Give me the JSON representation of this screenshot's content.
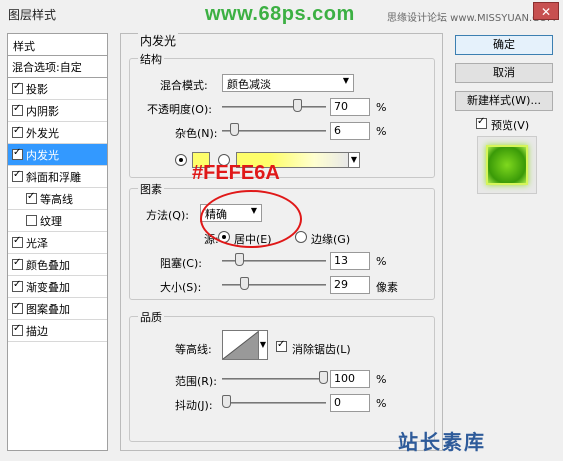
{
  "window": {
    "title": "图层样式",
    "close_glyph": "✕"
  },
  "watermark": {
    "top_url": "www.68ps.com",
    "top_sub": "思缘设计论坛 www.MISSYUAN.COM",
    "bottom": "站长素库"
  },
  "sidebar": {
    "header": "样式",
    "items": [
      {
        "label": "混合选项:自定",
        "check": null
      },
      {
        "label": "投影",
        "check": true
      },
      {
        "label": "内阴影",
        "check": true
      },
      {
        "label": "外发光",
        "check": true
      },
      {
        "label": "内发光",
        "check": true
      },
      {
        "label": "斜面和浮雕",
        "check": true
      },
      {
        "label": "等高线",
        "check": true
      },
      {
        "label": "纹理",
        "check": false
      },
      {
        "label": "光泽",
        "check": true
      },
      {
        "label": "颜色叠加",
        "check": true
      },
      {
        "label": "渐变叠加",
        "check": true
      },
      {
        "label": "图案叠加",
        "check": true
      },
      {
        "label": "描边",
        "check": true
      }
    ]
  },
  "panel": {
    "title": "内发光",
    "structure": {
      "legend": "结构",
      "blend_mode_label": "混合模式:",
      "blend_mode_value": "颜色减淡",
      "opacity_label": "不透明度(O):",
      "opacity_value": "70",
      "noise_label": "杂色(N):",
      "noise_value": "6",
      "percent": "%"
    },
    "elements": {
      "legend": "图素",
      "method_label": "方法(Q):",
      "method_value": "精确",
      "source_label": "源:",
      "source_center": "居中(E)",
      "source_edge": "边缘(G)",
      "choke_label": "阻塞(C):",
      "choke_value": "13",
      "size_label": "大小(S):",
      "size_value": "29",
      "px_unit": "像素"
    },
    "quality": {
      "legend": "品质",
      "contour_label": "等高线:",
      "anti_alias_label": "消除锯齿(L)",
      "range_label": "范围(R):",
      "range_value": "100",
      "jitter_label": "抖动(J):",
      "jitter_value": "0"
    }
  },
  "annotation": {
    "color_text": "#FEFE6A"
  },
  "buttons": {
    "ok": "确定",
    "cancel": "取消",
    "new_style": "新建样式(W)...",
    "preview": "预览(V)"
  },
  "colors": {
    "glow_color": "#fefe6a",
    "selection": "#3399ff",
    "annotation": "#e01818",
    "watermark_green": "#3cb043"
  }
}
